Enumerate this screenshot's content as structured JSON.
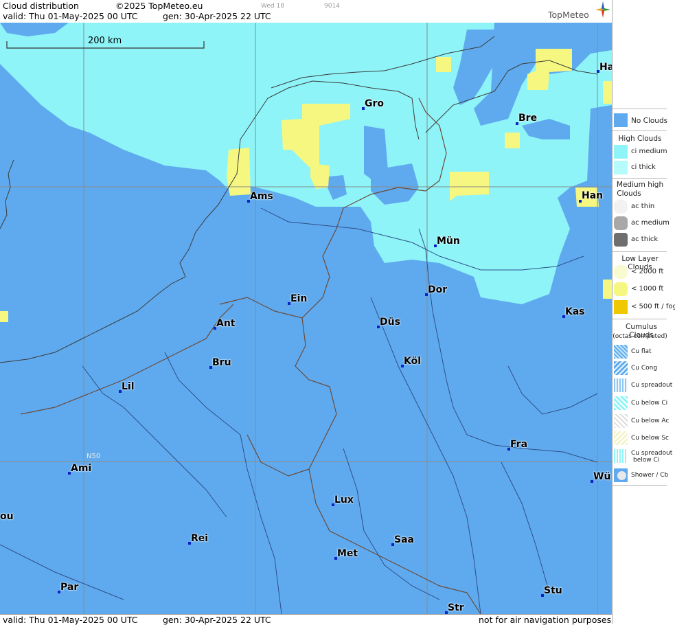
{
  "header": {
    "title": "Cloud distribution",
    "copyright": "©2025 TopMeteo.eu",
    "faint_day": "Wed 18",
    "faint_code": "9014",
    "valid": "valid:  Thu  01-May-2025  00 UTC",
    "generated": "gen: 30-Apr-2025 22 UTC",
    "logo": "TopMeteo"
  },
  "footer": {
    "valid": "valid:  Thu  01-May-2025  00 UTC",
    "generated": "gen: 30-Apr-2025 22 UTC",
    "disclaimer": "not for air navigation purposes"
  },
  "map": {
    "scale_label": "200 km",
    "latitude_label": "N50",
    "cities": [
      "Ha",
      "Gro",
      "Bre",
      "Ams",
      "Han",
      "Mün",
      "Dor",
      "Ein",
      "Kas",
      "Ant",
      "Düs",
      "Bru",
      "Köl",
      "Lil",
      "Fra",
      "Ami",
      "Wü",
      "Lux",
      "ou",
      "Rei",
      "Saa",
      "Met",
      "Stu",
      "Par",
      "Str"
    ]
  },
  "legend": {
    "no_clouds": "No Clouds",
    "high_clouds": "High Clouds",
    "ci_medium": "ci medium",
    "ci_thick": "ci thick",
    "medium_high_1": "Medium high",
    "medium_high_2": "Clouds",
    "ac_thin": "ac thin",
    "ac_medium": "ac medium",
    "ac_thick": "ac thick",
    "low_layer": "Low Layer Clouds",
    "lt2000": "< 2000 ft",
    "lt1000": "< 1000 ft",
    "lt500": "< 500 ft / fog",
    "cumulus_1": "Cumulus Clouds",
    "cumulus_2": "(octas computed)",
    "cu_flat": "Cu flat",
    "cu_cong": "Cu Cong",
    "cu_spreadout": "Cu spreadout",
    "cu_below_ci": "Cu below Ci",
    "cu_below_ac": "Cu below Ac",
    "cu_below_sc": "Cu below Sc",
    "cu_spread_ci_1": "Cu spreadout",
    "cu_spread_ci_2": "below Ci",
    "shower": "Shower / Cb"
  },
  "colors": {
    "no_clouds": "#5faaee",
    "ci": "#8ef4f8",
    "low": "#f6f780",
    "fog": "#f0c800",
    "city_marker": "#0b22c8"
  }
}
